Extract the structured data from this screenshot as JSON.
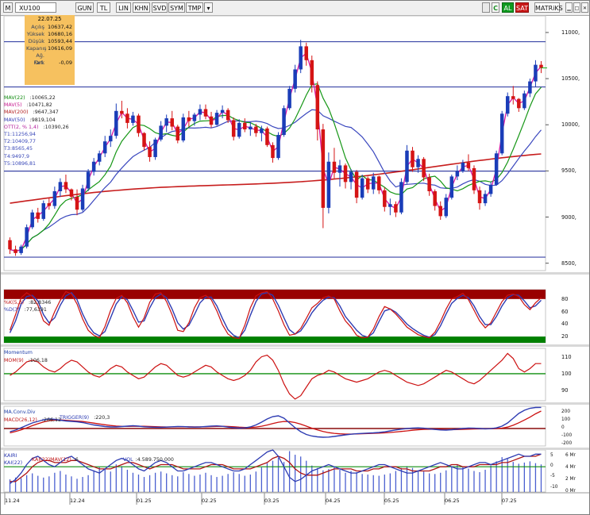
{
  "toolbar": {
    "symbol": "XU100",
    "buttons": [
      "M",
      "GUN",
      "TL",
      "LIN",
      "KHN",
      "SVD",
      "SYM",
      "TMP",
      "▾"
    ],
    "right": [
      "AL",
      "SAT",
      "MATRiKS"
    ]
  },
  "info_box": {
    "date": "22.07.25",
    "rows": [
      {
        "label": "Açılış",
        "value": "10637,42"
      },
      {
        "label": "Yüksek",
        "value": "10680,16"
      },
      {
        "label": "Düşük",
        "value": "10593,44"
      },
      {
        "label": "Kapanış",
        "value": "10616,09"
      },
      {
        "label": "Ağ. Ort.",
        "value": ""
      },
      {
        "label": "Fark",
        "value": "-0,09"
      }
    ]
  },
  "overlay_labels": [
    {
      "name": "MAV(22)",
      "value": ":10065,22",
      "color": "#0d8a0d"
    },
    {
      "name": "MAV(5)",
      "value": ":10471,82",
      "color": "#c8188f"
    },
    {
      "name": "MAV(200)",
      "value": ":9647,347",
      "color": "#b31d1d"
    },
    {
      "name": "MAV(50)",
      "value": ":9819,104",
      "color": "#323bb6"
    },
    {
      "name": "OTT(2, % 1,4)",
      "value": ":10390,26",
      "color": "#b6209e"
    },
    {
      "name": "T1:11256,94",
      "value": "",
      "color": "#3847b8"
    },
    {
      "name": "T2:10409,77",
      "value": "",
      "color": "#3847b8"
    },
    {
      "name": "T3:8565,45",
      "value": "",
      "color": "#3847b8"
    },
    {
      "name": "T4:9497,9",
      "value": "",
      "color": "#3847b8"
    },
    {
      "name": "T5:10896,81",
      "value": "",
      "color": "#3847b8"
    }
  ],
  "price_axis": [
    "11000,",
    "10500,",
    "10000,",
    "9500,",
    "9000,",
    "8500,"
  ],
  "x_labels": [
    "11.24",
    "12.24",
    "01.25",
    "02.25",
    "03.25",
    "04.25",
    "05.25",
    "06.25",
    "07.25"
  ],
  "stoch": {
    "labels": [
      {
        "name": "%K(5,3)",
        "value": ":82,8346",
        "color": "#c01515"
      },
      {
        "name": "%D(3)",
        "value": ":77,6391",
        "color": "#2d3bb2"
      }
    ],
    "axis": [
      "80",
      "60",
      "40",
      "20"
    ]
  },
  "momentum": {
    "title": "Momentum",
    "labels": [
      {
        "name": "MOM(9)",
        "value": ":106,18",
        "color": "#c01515"
      }
    ],
    "axis": [
      "110",
      "100",
      "90"
    ]
  },
  "macd": {
    "title": "MA.Conv.Div",
    "labels": [
      {
        "name": "MACD(26,12)",
        "value": ":266,12",
        "color": "#c01515"
      },
      {
        "name": "TRIGGER(9)",
        "value": ":220,3",
        "color": "#2d3bb2"
      }
    ],
    "axis": [
      "200",
      "100",
      "0",
      "-100",
      "-200"
    ]
  },
  "kairi": {
    "labels": [
      {
        "name": "KAIRI",
        "value": "",
        "color": "#2d3bb2"
      },
      {
        "name": "KAI(22)",
        "value": "",
        "color": "#2d3bb2"
      },
      {
        "name": "KAI(22)MAV(12)",
        "value": ":6",
        "color": "#c01515"
      },
      {
        "name": "VOL",
        "value": ":4.589.750.000",
        "color": "#2d3bb2"
      }
    ],
    "axis_left": [
      "5",
      "0",
      "-5",
      "-10"
    ],
    "axis_right": [
      "6 Mr",
      "4 Mr",
      "2 Mr",
      "0 Mr"
    ]
  },
  "colors": {
    "candle_up": "#1a3db8",
    "candle_down": "#d51414",
    "mav22": "#169716",
    "mav5": "#d716a3",
    "mav200": "#c71d1d",
    "mav50": "#3a47be",
    "hline": "#3a45a6",
    "stoch_band_top": "#990000",
    "stoch_band_bottom": "#008000",
    "mom_ref": "#0f8e0f"
  },
  "chart_data": {
    "type": "line",
    "candles": [
      [
        8750,
        8780,
        8600,
        8650
      ],
      [
        8650,
        8690,
        8580,
        8610
      ],
      [
        8610,
        8700,
        8590,
        8680
      ],
      [
        8680,
        8920,
        8660,
        8890
      ],
      [
        8890,
        9080,
        8870,
        9050
      ],
      [
        9050,
        9100,
        8940,
        8980
      ],
      [
        8980,
        9180,
        8960,
        9150
      ],
      [
        9150,
        9210,
        9080,
        9120
      ],
      [
        9120,
        9330,
        9090,
        9280
      ],
      [
        9280,
        9420,
        9220,
        9380
      ],
      [
        9380,
        9460,
        9260,
        9300
      ],
      [
        9300,
        9310,
        9180,
        9220
      ],
      [
        9220,
        9300,
        9020,
        9080
      ],
      [
        9080,
        9350,
        9060,
        9310
      ],
      [
        9310,
        9520,
        9280,
        9490
      ],
      [
        9490,
        9640,
        9450,
        9600
      ],
      [
        9600,
        9720,
        9560,
        9690
      ],
      [
        9690,
        9880,
        9650,
        9820
      ],
      [
        9820,
        9950,
        9760,
        9880
      ],
      [
        9880,
        10230,
        9850,
        10150
      ],
      [
        10150,
        10260,
        10070,
        10120
      ],
      [
        10120,
        10180,
        9960,
        10020
      ],
      [
        10020,
        10140,
        9990,
        10100
      ],
      [
        10100,
        10120,
        9870,
        9910
      ],
      [
        9910,
        9920,
        9720,
        9760
      ],
      [
        9760,
        9820,
        9600,
        9650
      ],
      [
        9650,
        9860,
        9620,
        9840
      ],
      [
        9840,
        10040,
        9820,
        9990
      ],
      [
        9990,
        10110,
        9920,
        10070
      ],
      [
        10070,
        10150,
        9940,
        9980
      ],
      [
        9980,
        10000,
        9800,
        9830
      ],
      [
        9830,
        10120,
        9810,
        10080
      ],
      [
        10080,
        10150,
        9980,
        10040
      ],
      [
        10040,
        10130,
        9990,
        10110
      ],
      [
        10110,
        10220,
        10050,
        10170
      ],
      [
        10170,
        10220,
        10060,
        10090
      ],
      [
        10090,
        10140,
        9970,
        10000
      ],
      [
        10000,
        10160,
        9990,
        10130
      ],
      [
        10130,
        10210,
        10070,
        10160
      ],
      [
        10160,
        10180,
        10020,
        10050
      ],
      [
        10050,
        10080,
        9830,
        9870
      ],
      [
        9870,
        10060,
        9850,
        10020
      ],
      [
        10020,
        10070,
        9920,
        9950
      ],
      [
        9950,
        10030,
        9880,
        9980
      ],
      [
        9980,
        10010,
        9870,
        9910
      ],
      [
        9910,
        9990,
        9820,
        9960
      ],
      [
        9960,
        9980,
        9760,
        9780
      ],
      [
        9780,
        9810,
        9590,
        9640
      ],
      [
        9640,
        9920,
        9620,
        9890
      ],
      [
        9890,
        10210,
        9870,
        10180
      ],
      [
        10180,
        10420,
        10160,
        10390
      ],
      [
        10390,
        10650,
        10350,
        10600
      ],
      [
        10600,
        10920,
        10560,
        10850
      ],
      [
        10850,
        10890,
        10640,
        10700
      ],
      [
        10700,
        10750,
        10350,
        10430
      ],
      [
        10430,
        10470,
        9830,
        9950
      ],
      [
        9950,
        10010,
        8880,
        9100
      ],
      [
        9100,
        9700,
        9040,
        9600
      ],
      [
        9600,
        9750,
        9420,
        9480
      ],
      [
        9480,
        9620,
        9330,
        9560
      ],
      [
        9560,
        9580,
        9310,
        9380
      ],
      [
        9380,
        9520,
        9300,
        9490
      ],
      [
        9490,
        9510,
        9150,
        9210
      ],
      [
        9210,
        9460,
        9190,
        9420
      ],
      [
        9420,
        9440,
        9260,
        9300
      ],
      [
        9300,
        9480,
        9250,
        9440
      ],
      [
        9440,
        9450,
        9250,
        9290
      ],
      [
        9290,
        9320,
        9060,
        9110
      ],
      [
        9110,
        9200,
        9020,
        9140
      ],
      [
        9140,
        9170,
        9000,
        9050
      ],
      [
        9050,
        9420,
        9030,
        9380
      ],
      [
        9380,
        9780,
        9360,
        9720
      ],
      [
        9720,
        9760,
        9490,
        9540
      ],
      [
        9540,
        9670,
        9480,
        9630
      ],
      [
        9630,
        9650,
        9390,
        9430
      ],
      [
        9430,
        9470,
        9230,
        9280
      ],
      [
        9280,
        9300,
        9070,
        9120
      ],
      [
        9120,
        9170,
        8970,
        9010
      ],
      [
        9010,
        9250,
        8990,
        9210
      ],
      [
        9210,
        9460,
        9190,
        9440
      ],
      [
        9440,
        9560,
        9400,
        9500
      ],
      [
        9500,
        9620,
        9480,
        9590
      ],
      [
        9590,
        9680,
        9500,
        9530
      ],
      [
        9530,
        9560,
        9250,
        9290
      ],
      [
        9290,
        9330,
        9080,
        9150
      ],
      [
        9150,
        9290,
        9120,
        9250
      ],
      [
        9250,
        9380,
        9220,
        9350
      ],
      [
        9350,
        9720,
        9340,
        9690
      ],
      [
        9690,
        10150,
        9670,
        10120
      ],
      [
        10120,
        10350,
        10090,
        10310
      ],
      [
        10310,
        10420,
        10220,
        10280
      ],
      [
        10280,
        10290,
        10140,
        10180
      ],
      [
        10180,
        10370,
        10160,
        10340
      ],
      [
        10340,
        10500,
        10300,
        10470
      ],
      [
        10470,
        10700,
        10410,
        10650
      ],
      [
        10650,
        10690,
        10560,
        10616
      ]
    ],
    "stoch_k": [
      30,
      55,
      82,
      90,
      84,
      70,
      45,
      38,
      60,
      78,
      92,
      88,
      72,
      48,
      30,
      22,
      18,
      36,
      62,
      81,
      86,
      74,
      52,
      35,
      50,
      75,
      88,
      90,
      76,
      55,
      30,
      28,
      42,
      66,
      82,
      86,
      79,
      61,
      39,
      24,
      18,
      17,
      38,
      66,
      85,
      90,
      92,
      80,
      61,
      39,
      22,
      24,
      33,
      49,
      66,
      73,
      82,
      85,
      80,
      61,
      45,
      35,
      22,
      18,
      19,
      32,
      52,
      68,
      64,
      56,
      46,
      35,
      29,
      23,
      20,
      18,
      27,
      44,
      64,
      80,
      84,
      89,
      79,
      62,
      45,
      34,
      42,
      59,
      76,
      86,
      88,
      84,
      71,
      63,
      74,
      82
    ],
    "stoch_d": [
      26,
      45,
      72,
      84,
      86,
      77,
      55,
      42,
      50,
      70,
      85,
      90,
      79,
      56,
      38,
      26,
      21,
      28,
      50,
      72,
      84,
      79,
      62,
      43,
      45,
      66,
      82,
      88,
      82,
      64,
      42,
      32,
      38,
      55,
      74,
      83,
      83,
      69,
      49,
      31,
      22,
      18,
      30,
      54,
      76,
      88,
      90,
      86,
      70,
      50,
      31,
      24,
      29,
      42,
      58,
      69,
      78,
      83,
      82,
      69,
      52,
      41,
      30,
      22,
      19,
      26,
      44,
      61,
      64,
      59,
      50,
      40,
      33,
      27,
      22,
      19,
      23,
      37,
      56,
      73,
      81,
      86,
      82,
      69,
      52,
      39,
      39,
      52,
      69,
      82,
      87,
      86,
      77,
      66,
      69,
      78
    ],
    "momentum": [
      99,
      101,
      104,
      107,
      108,
      107,
      104,
      102,
      101,
      103,
      106,
      108,
      107,
      104,
      101,
      99,
      98,
      100,
      103,
      105,
      104,
      101,
      99,
      97,
      98,
      101,
      104,
      106,
      105,
      102,
      99,
      98,
      99,
      101,
      103,
      105,
      104,
      101,
      99,
      97,
      96,
      97,
      99,
      102,
      107,
      110,
      111,
      108,
      102,
      94,
      88,
      85,
      87,
      92,
      97,
      99,
      100,
      102,
      101,
      99,
      97,
      96,
      95,
      96,
      97,
      99,
      101,
      102,
      101,
      99,
      97,
      95,
      94,
      93,
      94,
      96,
      98,
      100,
      102,
      101,
      99,
      97,
      95,
      94,
      96,
      99,
      102,
      105,
      108,
      112,
      109,
      103,
      101,
      103,
      106,
      106
    ],
    "macd": [
      -40,
      -20,
      10,
      40,
      70,
      90,
      110,
      120,
      115,
      105,
      95,
      90,
      85,
      75,
      60,
      45,
      35,
      25,
      20,
      20,
      25,
      30,
      35,
      30,
      22,
      18,
      16,
      15,
      18,
      22,
      25,
      24,
      20,
      18,
      20,
      25,
      30,
      33,
      28,
      18,
      10,
      5,
      8,
      20,
      45,
      80,
      120,
      150,
      160,
      130,
      70,
      10,
      -40,
      -75,
      -95,
      -105,
      -110,
      -108,
      -100,
      -90,
      -80,
      -72,
      -66,
      -62,
      -58,
      -55,
      -50,
      -42,
      -30,
      -18,
      -8,
      0,
      6,
      8,
      4,
      -4,
      -12,
      -18,
      -20,
      -16,
      -8,
      0,
      5,
      4,
      0,
      -4,
      -2,
      8,
      30,
      70,
      130,
      190,
      230,
      255,
      265,
      266
    ],
    "trigger": [
      -55,
      -38,
      -18,
      8,
      36,
      60,
      82,
      98,
      107,
      108,
      104,
      99,
      94,
      88,
      79,
      68,
      57,
      47,
      38,
      31,
      27,
      26,
      28,
      29,
      28,
      26,
      23,
      21,
      20,
      20,
      21,
      22,
      22,
      21,
      21,
      22,
      24,
      27,
      28,
      26,
      22,
      17,
      14,
      14,
      19,
      29,
      44,
      62,
      79,
      89,
      87,
      75,
      55,
      30,
      4,
      -18,
      -37,
      -52,
      -61,
      -67,
      -70,
      -70,
      -68,
      -66,
      -63,
      -61,
      -58,
      -55,
      -50,
      -44,
      -37,
      -30,
      -22,
      -16,
      -11,
      -10,
      -10,
      -12,
      -14,
      -15,
      -14,
      -11,
      -8,
      -6,
      -5,
      -5,
      -4,
      -1,
      5,
      18,
      41,
      72,
      107,
      143,
      185,
      220
    ],
    "kairi": [
      -8,
      -6,
      -3,
      1,
      4,
      5,
      3,
      1,
      0,
      2,
      4,
      5,
      3,
      1,
      -1,
      -2,
      -3,
      -1,
      1,
      3,
      4,
      3,
      1,
      -1,
      -2,
      0,
      2,
      3,
      2,
      0,
      -2,
      -2,
      -1,
      0,
      1,
      2,
      2,
      1,
      0,
      -1,
      -2,
      -2,
      -1,
      1,
      3,
      5,
      7,
      8,
      5,
      0,
      -5,
      -7,
      -6,
      -4,
      -2,
      -1,
      0,
      1,
      0,
      -1,
      -2,
      -3,
      -3,
      -2,
      -1,
      0,
      1,
      1,
      0,
      -1,
      -2,
      -3,
      -3,
      -2,
      -1,
      0,
      1,
      2,
      1,
      0,
      -1,
      -1,
      0,
      1,
      2,
      2,
      1,
      2,
      3,
      4,
      5,
      6,
      5,
      5,
      6,
      6
    ],
    "kairi_mav": [
      -7,
      -7,
      -5,
      -3,
      0,
      2,
      3,
      3,
      2,
      2,
      2,
      3,
      3,
      2,
      1,
      0,
      -1,
      -1,
      -1,
      0,
      1,
      2,
      2,
      1,
      0,
      -1,
      0,
      1,
      1,
      1,
      0,
      -1,
      -1,
      -1,
      -1,
      0,
      1,
      1,
      1,
      0,
      -1,
      -1,
      -1,
      -1,
      0,
      1,
      2,
      4,
      5,
      4,
      2,
      -1,
      -3,
      -4,
      -4,
      -4,
      -3,
      -2,
      -1,
      -1,
      -1,
      -1,
      -2,
      -2,
      -2,
      -1,
      -1,
      0,
      0,
      0,
      -1,
      -1,
      -2,
      -2,
      -2,
      -2,
      -1,
      0,
      0,
      1,
      1,
      0,
      0,
      0,
      1,
      1,
      1,
      1,
      2,
      2,
      3,
      4,
      5,
      5,
      5,
      6
    ],
    "volume": [
      2.1,
      2.4,
      2.3,
      2.8,
      3.1,
      2.7,
      2.4,
      2.6,
      3.2,
      3.5,
      2.9,
      2.6,
      2.2,
      2.5,
      2.8,
      3.6,
      4.1,
      3.8,
      3.4,
      4.6,
      4.3,
      3.7,
      3.2,
      2.9,
      2.5,
      2.8,
      3.2,
      3.4,
      3.1,
      2.8,
      2.6,
      3.3,
      3.0,
      2.7,
      2.9,
      3.2,
      2.8,
      2.5,
      2.7,
      3.0,
      3.3,
      3.0,
      2.7,
      2.9,
      3.4,
      4.1,
      4.8,
      5.2,
      5.7,
      5.0,
      6.8,
      6.2,
      5.9,
      5.2,
      4.4,
      4.0,
      3.6,
      3.8,
      4.1,
      3.7,
      3.2,
      3.5,
      3.3,
      3.0,
      2.9,
      2.8,
      2.7,
      2.9,
      3.1,
      3.5,
      4.0,
      4.3,
      4.0,
      3.6,
      3.4,
      3.1,
      3.0,
      3.2,
      3.6,
      4.2,
      4.5,
      4.1,
      3.9,
      3.5,
      3.3,
      3.7,
      4.4,
      5.1,
      5.8,
      5.5,
      5.0,
      4.7,
      4.9,
      5.1,
      4.8,
      4.59
    ],
    "price_ylim": [
      8420,
      11180
    ],
    "price_hlines": [
      10900,
      10409.77,
      9497.9,
      8565.45
    ],
    "stoch_ylim": [
      10,
      95
    ],
    "mom_ylim": [
      84,
      115
    ],
    "macd_ylim": [
      -220,
      280
    ],
    "kairi_ylim": [
      -12,
      8
    ],
    "volume_ylim": [
      0,
      7
    ]
  }
}
